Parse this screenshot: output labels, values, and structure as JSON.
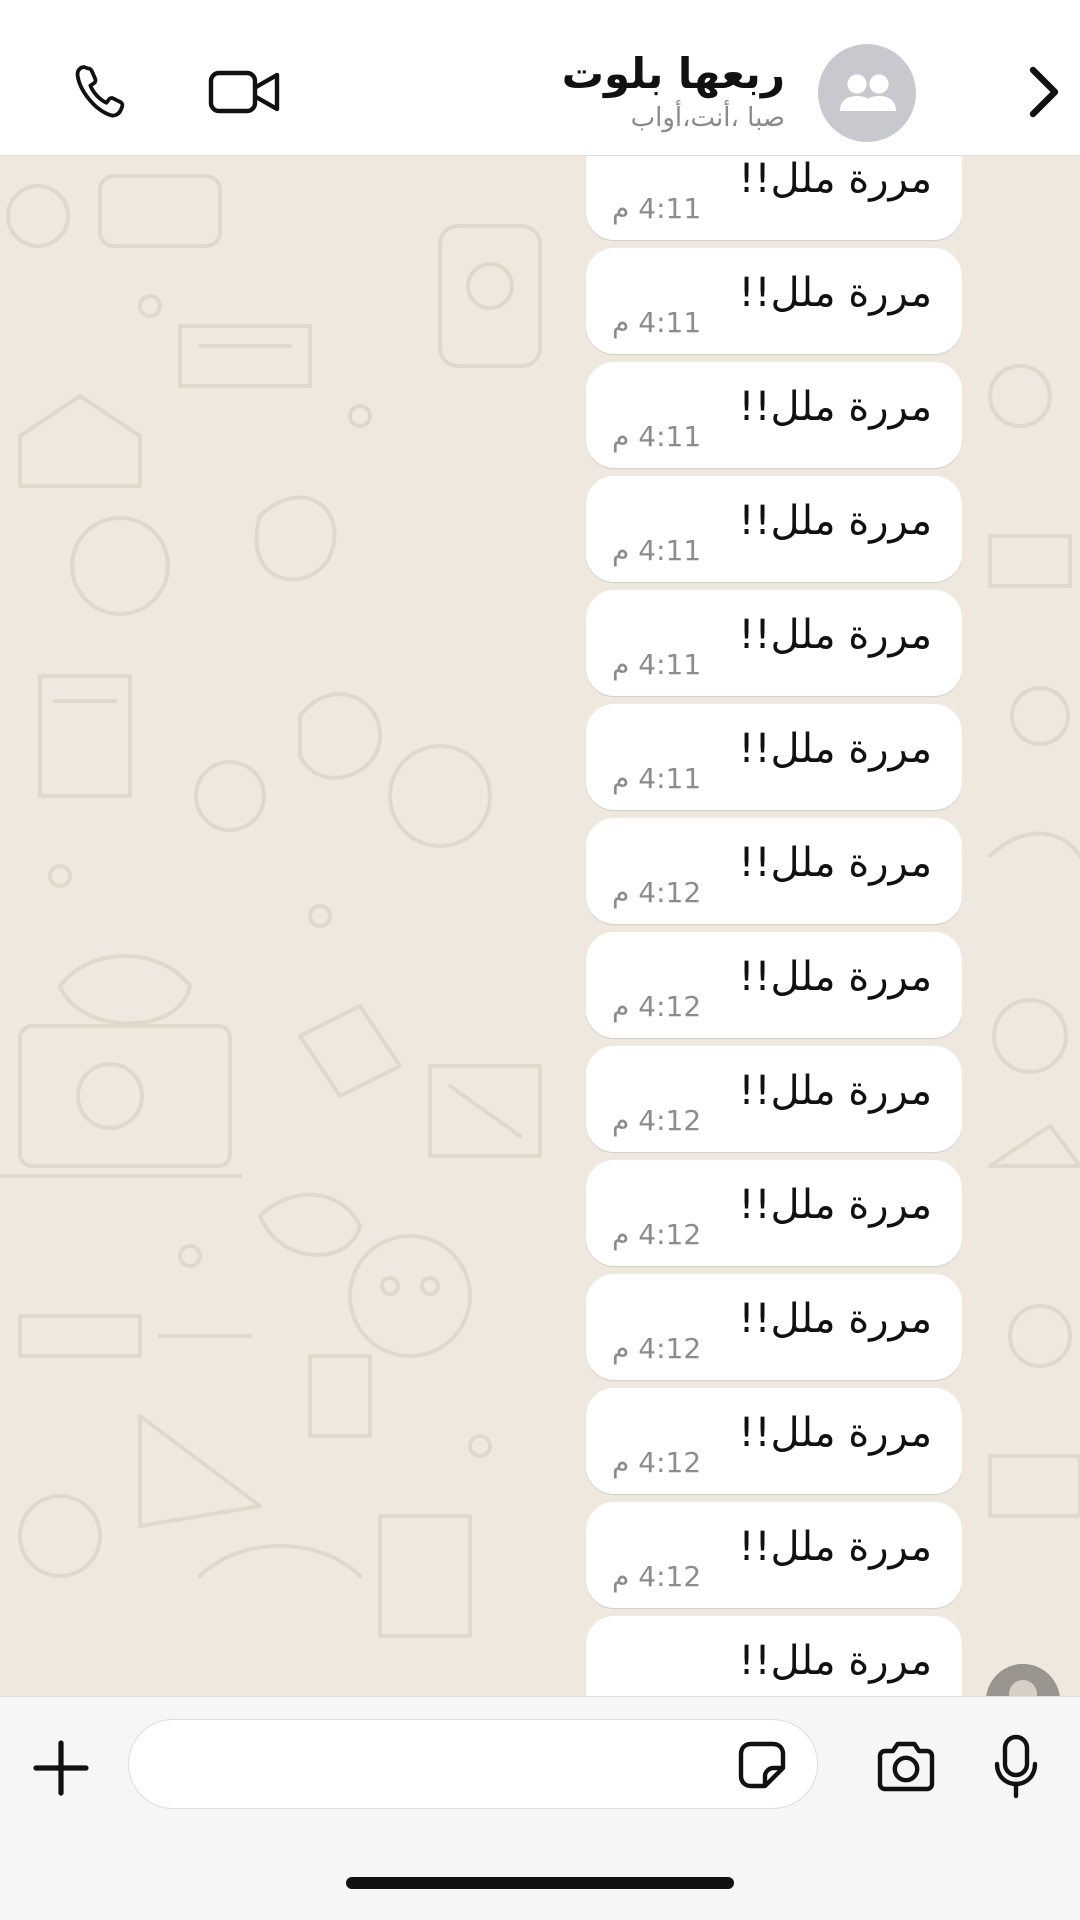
{
  "header": {
    "title": "ربعها بلوت",
    "subtitle": "صبا ،أنت،أواب",
    "call_icon": "phone-icon",
    "video_icon": "video-camera-icon",
    "back_icon": "chevron-right-icon",
    "avatar_icon": "group-icon"
  },
  "messages": [
    {
      "text": "مررة ملل!!",
      "time": "4:11 م"
    },
    {
      "text": "مررة ملل!!",
      "time": "4:11 م"
    },
    {
      "text": "مررة ملل!!",
      "time": "4:11 م"
    },
    {
      "text": "مررة ملل!!",
      "time": "4:11 م"
    },
    {
      "text": "مررة ملل!!",
      "time": "4:11 م"
    },
    {
      "text": "مررة ملل!!",
      "time": "4:11 م"
    },
    {
      "text": "مررة ملل!!",
      "time": "4:12 م"
    },
    {
      "text": "مررة ملل!!",
      "time": "4:12 م"
    },
    {
      "text": "مررة ملل!!",
      "time": "4:12 م"
    },
    {
      "text": "مررة ملل!!",
      "time": "4:12 م"
    },
    {
      "text": "مررة ملل!!",
      "time": "4:12 م"
    },
    {
      "text": "مررة ملل!!",
      "time": "4:12 م"
    },
    {
      "text": "مررة ملل!!",
      "time": "4:12 م"
    },
    {
      "text": "مررة ملل!!",
      "time": ""
    }
  ],
  "composer": {
    "placeholder": "",
    "plus_icon": "plus-icon",
    "sticker_icon": "sticker-icon",
    "camera_icon": "camera-icon",
    "mic_icon": "microphone-icon"
  },
  "colors": {
    "background": "#efe8de",
    "bubble": "#ffffff",
    "header": "#ffffff",
    "icon": "#111111"
  }
}
